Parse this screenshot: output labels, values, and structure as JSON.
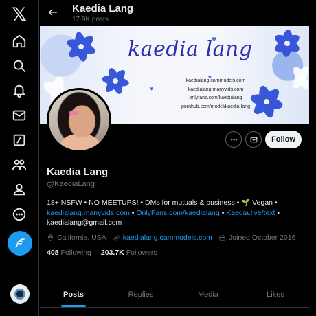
{
  "app": {
    "logo": "𝕏"
  },
  "nav": [
    {
      "icon": "home-icon"
    },
    {
      "icon": "search-icon"
    },
    {
      "icon": "notifications-icon"
    },
    {
      "icon": "messages-icon"
    },
    {
      "icon": "grok-icon"
    },
    {
      "icon": "communities-icon"
    },
    {
      "icon": "profile-icon"
    },
    {
      "icon": "more-icon"
    }
  ],
  "header": {
    "name": "Kaedia Lang",
    "posts": "17.9K posts"
  },
  "banner": {
    "title": "kaedia lang",
    "links": [
      "kaedialang.cammodels.com",
      "kaedialang.manyvids.com",
      "onlyfans.com/kaedialang",
      "pornhub.com/model/kaedia-lang"
    ]
  },
  "actions": {
    "follow": "Follow"
  },
  "profile": {
    "name": "Kaedia Lang",
    "handle": "@KaediaLang",
    "bio_line1": "18+ NSFW • NO MEETUPS! • DMs for mutuals & business • 🌱 Vegan •",
    "bio_link1": "kaedialang.manyvids.com",
    "bio_sep1": " • ",
    "bio_link2": "OnlyFans.com/kaedialang",
    "bio_sep2": " • ",
    "bio_link3": "Kaedia.live/text",
    "bio_sep3": " •",
    "bio_email": "kaedialang@gmail.com",
    "location": "California, USA",
    "website": "kaedialang.cammodels.com",
    "joined": "Joined October 2016",
    "following_count": "408",
    "following_label": "Following",
    "followers_count": "203.7K",
    "followers_label": "Followers"
  },
  "tabs": [
    "Posts",
    "Replies",
    "Media",
    "Likes"
  ],
  "colors": {
    "accent": "#1d9bf0",
    "background": "#000000",
    "text": "#e7e9ea",
    "muted": "#71767b"
  }
}
